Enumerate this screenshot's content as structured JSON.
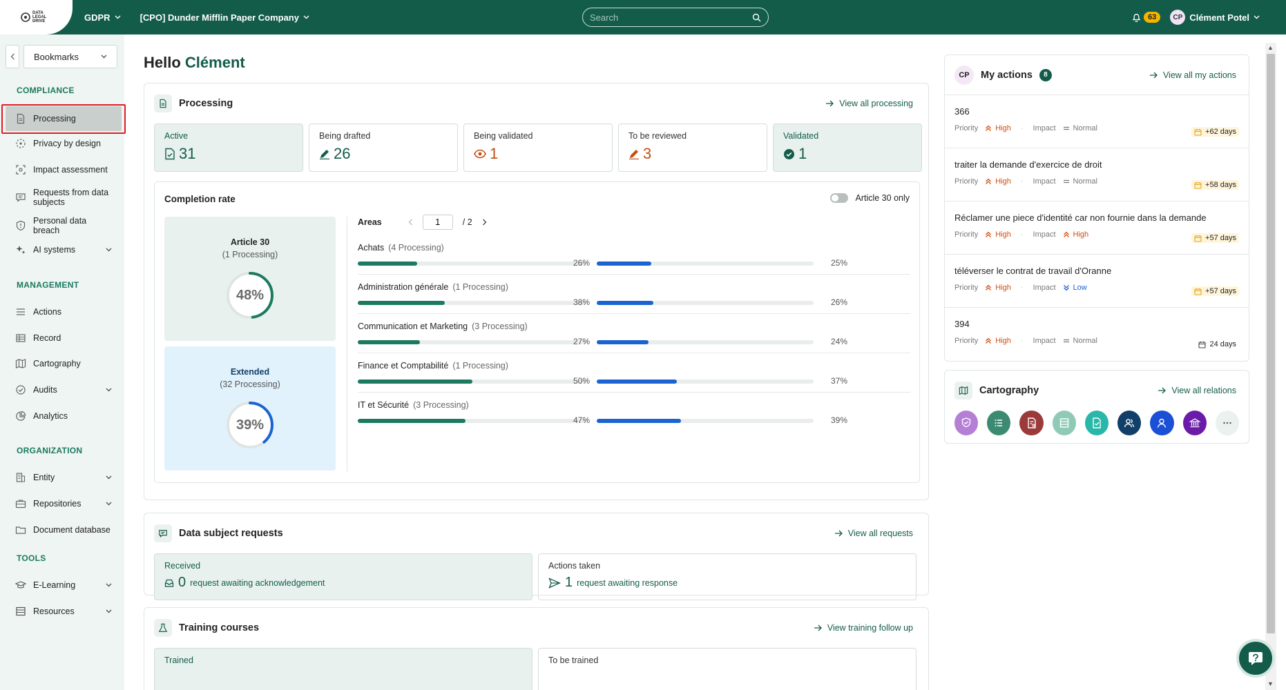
{
  "topbar": {
    "logo_text": "DATA LEGAL DRIVE",
    "module": "GDPR",
    "company": "[CPO] Dunder Mifflin Paper Company",
    "search_placeholder": "Search",
    "notifications_count": "63",
    "user_initials": "CP",
    "user_name": "Clément Potel"
  },
  "sidebar": {
    "bookmarks_label": "Bookmarks",
    "sections": {
      "compliance": "COMPLIANCE",
      "management": "MANAGEMENT",
      "organization": "ORGANIZATION",
      "tools": "TOOLS"
    },
    "items": {
      "processing": "Processing",
      "privacy_by_design": "Privacy by design",
      "impact_assessment": "Impact assessment",
      "requests": "Requests from data subjects",
      "breach": "Personal data breach",
      "ai_systems": "AI systems",
      "actions": "Actions",
      "record": "Record",
      "cartography": "Cartography",
      "audits": "Audits",
      "analytics": "Analytics",
      "entity": "Entity",
      "repositories": "Repositories",
      "document_database": "Document database",
      "elearning": "E-Learning",
      "resources": "Resources"
    }
  },
  "greeting": {
    "hello": "Hello",
    "name": "Clément"
  },
  "processing": {
    "title": "Processing",
    "view_all": "View all processing",
    "stats": [
      {
        "label": "Active",
        "value": "31",
        "icon": "document-check-icon"
      },
      {
        "label": "Being drafted",
        "value": "26",
        "icon": "pencil-icon"
      },
      {
        "label": "Being validated",
        "value": "1",
        "icon": "eye-icon"
      },
      {
        "label": "To be reviewed",
        "value": "3",
        "icon": "pen-edit-icon"
      },
      {
        "label": "Validated",
        "value": "1",
        "icon": "check-circle-icon"
      }
    ]
  },
  "completion": {
    "title": "Completion rate",
    "toggle_label": "Article 30 only",
    "article30": {
      "title": "Article 30",
      "sub": "(1 Processing)",
      "pct": 48,
      "pct_label": "48%"
    },
    "extended": {
      "title": "Extended",
      "sub": "(32 Processing)",
      "pct": 39,
      "pct_label": "39%"
    },
    "areas_label": "Areas",
    "page": "1",
    "page_total": "/ 2",
    "areas": [
      {
        "name": "Achats",
        "count": "(4 Processing)",
        "a30": 26,
        "a30_label": "26%",
        "ext": 25,
        "ext_label": "25%"
      },
      {
        "name": "Administration générale",
        "count": "(1 Processing)",
        "a30": 38,
        "a30_label": "38%",
        "ext": 26,
        "ext_label": "26%"
      },
      {
        "name": "Communication et Marketing",
        "count": "(3 Processing)",
        "a30": 27,
        "a30_label": "27%",
        "ext": 24,
        "ext_label": "24%"
      },
      {
        "name": "Finance et Comptabilité",
        "count": "(1 Processing)",
        "a30": 50,
        "a30_label": "50%",
        "ext": 37,
        "ext_label": "37%"
      },
      {
        "name": "IT et Sécurité",
        "count": "(3 Processing)",
        "a30": 47,
        "a30_label": "47%",
        "ext": 39,
        "ext_label": "39%"
      }
    ]
  },
  "requests": {
    "title": "Data subject requests",
    "view_all": "View all requests",
    "received_label": "Received",
    "received_value": "0",
    "received_text": "request awaiting acknowledgement",
    "actions_label": "Actions taken",
    "actions_value": "1",
    "actions_text": "request awaiting response"
  },
  "training": {
    "title": "Training courses",
    "view_all": "View training follow up",
    "trained_label": "Trained",
    "to_train_label": "To be trained"
  },
  "my_actions": {
    "avatar": "CP",
    "title": "My actions",
    "count": "8",
    "view_all": "View all my actions",
    "priority_label": "Priority",
    "impact_label": "Impact",
    "items": [
      {
        "title": "366",
        "priority": "High",
        "impact": "Normal",
        "impact_level": "normal",
        "due": "+62 days",
        "overdue": true
      },
      {
        "title": "traiter la demande d'exercice de droit",
        "priority": "High",
        "impact": "Normal",
        "impact_level": "normal",
        "due": "+58 days",
        "overdue": true
      },
      {
        "title": "Réclamer une piece d'identité car non fournie dans la demande",
        "priority": "High",
        "impact": "High",
        "impact_level": "high",
        "due": "+57 days",
        "overdue": true
      },
      {
        "title": "téléverser le contrat de travail d'Oranne",
        "priority": "High",
        "impact": "Low",
        "impact_level": "low",
        "due": "+57 days",
        "overdue": true
      },
      {
        "title": "394",
        "priority": "High",
        "impact": "Normal",
        "impact_level": "normal",
        "due": "24 days",
        "overdue": false
      }
    ]
  },
  "cartography": {
    "title": "Cartography",
    "view_all": "View all relations",
    "icons": [
      {
        "name": "shield-check-icon",
        "bg": "#b57fd6"
      },
      {
        "name": "list-icon",
        "bg": "#3d8a72"
      },
      {
        "name": "document-search-icon",
        "bg": "#9b3a3a"
      },
      {
        "name": "table-icon",
        "bg": "#8fcab7"
      },
      {
        "name": "document-check-icon",
        "bg": "#28b7a8"
      },
      {
        "name": "users-icon",
        "bg": "#123f69"
      },
      {
        "name": "user-icon",
        "bg": "#1b4fd6"
      },
      {
        "name": "bank-icon",
        "bg": "#6a1ba8"
      },
      {
        "name": "more-icon",
        "bg": "#eaf1ee"
      }
    ]
  },
  "colors": {
    "brand": "#135c4a",
    "article30_bar": "#1b7a5f",
    "extended_bar": "#1a63d1",
    "high": "#d24b12",
    "low": "#1a5fd1"
  }
}
